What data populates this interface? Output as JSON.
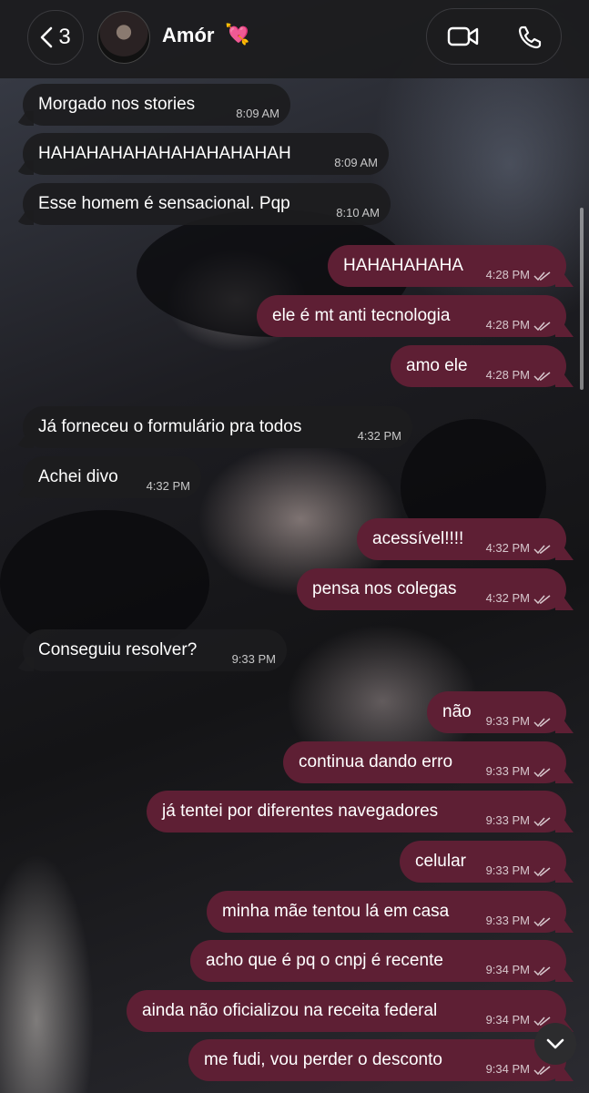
{
  "header": {
    "back_count": "3",
    "contact_name": "Amór",
    "contact_emoji": "💘"
  },
  "messages": [
    {
      "text": "Morgado nos stories",
      "time": "8:09 AM",
      "direction": "in"
    },
    {
      "text": "HAHAHAHAHAHAHAHAHAHAH",
      "time": "8:09 AM",
      "direction": "in"
    },
    {
      "text": "Esse homem é sensacional. Pqp",
      "time": "8:10 AM",
      "direction": "in"
    },
    {
      "text": "HAHAHAHAHA",
      "time": "4:28 PM",
      "direction": "out"
    },
    {
      "text": "ele é mt anti tecnologia",
      "time": "4:28 PM",
      "direction": "out"
    },
    {
      "text": "amo ele",
      "time": "4:28 PM",
      "direction": "out"
    },
    {
      "text": "Já forneceu o formulário pra todos",
      "time": "4:32 PM",
      "direction": "in"
    },
    {
      "text": "Achei divo",
      "time": "4:32 PM",
      "direction": "in"
    },
    {
      "text": "acessível!!!!",
      "time": "4:32 PM",
      "direction": "out"
    },
    {
      "text": "pensa nos colegas",
      "time": "4:32 PM",
      "direction": "out"
    },
    {
      "text": "Conseguiu resolver?",
      "time": "9:33 PM",
      "direction": "in"
    },
    {
      "text": "não",
      "time": "9:33 PM",
      "direction": "out"
    },
    {
      "text": "continua dando erro",
      "time": "9:33 PM",
      "direction": "out"
    },
    {
      "text": "já tentei por diferentes navegadores",
      "time": "9:33 PM",
      "direction": "out"
    },
    {
      "text": "celular",
      "time": "9:33 PM",
      "direction": "out"
    },
    {
      "text": "minha mãe tentou lá em casa",
      "time": "9:33 PM",
      "direction": "out"
    },
    {
      "text": "acho que é pq o cnpj é recente",
      "time": "9:34 PM",
      "direction": "out"
    },
    {
      "text": "ainda não oficializou na receita federal",
      "time": "9:34 PM",
      "direction": "out"
    },
    {
      "text": "me fudi, vou perder o desconto",
      "time": "9:34 PM",
      "direction": "out"
    }
  ],
  "colors": {
    "outgoing_bubble": "#5e1f34",
    "incoming_bubble": "#1c1c1e",
    "text": "#ffffff"
  },
  "icons": {
    "back": "chevron-left-icon",
    "video": "video-camera-icon",
    "call": "phone-icon",
    "read_receipt": "double-check-icon",
    "scroll_down": "chevron-down-icon"
  }
}
